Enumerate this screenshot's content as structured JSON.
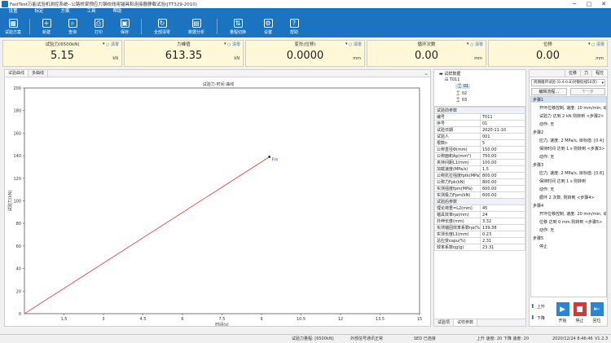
{
  "window": {
    "title": "FastTest万能试验机测控系统--公路桥梁预应力钢绞线用锚具和连接器静载试验(JTT329-2010)",
    "minimize": "─",
    "maximize": "□",
    "close": "✕"
  },
  "menu": [
    "设置",
    "标定",
    "方案",
    "工具",
    "帮助"
  ],
  "toolbar": [
    {
      "label": "试验方案",
      "icon": "grid-icon"
    },
    {
      "label": "新建",
      "icon": "plus-icon"
    },
    {
      "label": "查询",
      "icon": "search-icon"
    },
    {
      "label": "打印",
      "icon": "print-icon"
    },
    {
      "label": "保存",
      "icon": "save-icon"
    },
    {
      "label": "全部清零",
      "icon": "refresh-icon"
    },
    {
      "label": "数据分析",
      "icon": "chart-icon"
    },
    {
      "label": "量程切换",
      "icon": "range-icon"
    },
    {
      "label": "设置",
      "icon": "settings-icon"
    },
    {
      "label": "帮助",
      "icon": "help-icon"
    }
  ],
  "meters": [
    {
      "label": "试验力(6500kN)",
      "zero": "清零",
      "value": "5.15",
      "unit": "kN"
    },
    {
      "label": "力峰值",
      "zero": "清零",
      "value": "613.35",
      "unit": "kN"
    },
    {
      "label": "变形(位移)",
      "zero": "清零",
      "value": "0.0000",
      "unit": "mm"
    },
    {
      "label": "循环次数",
      "zero": "清零",
      "value": "0.00",
      "unit": "mm"
    },
    {
      "label": "位移",
      "zero": "清零",
      "value": "0.00",
      "unit": "mm"
    }
  ],
  "chart_tabs": [
    "试验曲线",
    "多曲线"
  ],
  "chart_data": {
    "type": "line",
    "title": "试验力-时间 曲线",
    "xlabel": "时间(s)",
    "ylabel": "试验力(kN)",
    "xlim": [
      0,
      15
    ],
    "ylim": [
      0,
      200
    ],
    "xticks": [
      "1.5",
      "3",
      "4.5",
      "6",
      "7.5",
      "9",
      "10.5",
      "12",
      "13.5",
      "15"
    ],
    "yticks": [
      "20",
      "40",
      "60",
      "80",
      "100",
      "120",
      "140",
      "160",
      "180",
      "200"
    ],
    "origin_label": "0",
    "series": [
      {
        "color": "#e03a3a",
        "x": [
          0,
          9.3
        ],
        "y": [
          0,
          139
        ]
      }
    ],
    "marker": {
      "x": 9.3,
      "y": 139,
      "label": "Fm"
    }
  },
  "tree": {
    "header": "试样数据",
    "root": "T011",
    "samples": [
      "01",
      "02",
      "03"
    ]
  },
  "params": [
    {
      "section": "试验前参数"
    },
    {
      "k": "编号",
      "v": "T011"
    },
    {
      "k": "序号",
      "v": "01"
    },
    {
      "k": "试验日期",
      "v": "2020-11-10"
    },
    {
      "k": "试验人",
      "v": "001"
    },
    {
      "k": "根数n",
      "v": "5"
    },
    {
      "k": "公称直径Φ(mm)",
      "v": "150.00"
    },
    {
      "k": "公称面积Ap(mm²)",
      "v": "750.00"
    },
    {
      "k": "夹持间距L1(mm)",
      "v": "100.00"
    },
    {
      "k": "加载速度(MPa/s)",
      "v": "1.5"
    },
    {
      "k": "公称抗拉强度fptk(MPa)",
      "v": "800.00"
    },
    {
      "k": "公称力Fpk(kN)",
      "v": "800.00"
    },
    {
      "k": "实测强度fpm(MPa)",
      "v": "600.00"
    },
    {
      "k": "实测极力Fpm(kN)",
      "v": "600.00"
    },
    {
      "section": "试验后参数"
    },
    {
      "k": "理论荷重=L2(mm)",
      "v": "45"
    },
    {
      "k": "锚具效率ηa(mm)",
      "v": "24"
    },
    {
      "k": "外伸长度(mm)",
      "v": "3.32"
    },
    {
      "k": "实测锚固效率系数ηa(%)",
      "v": "139.38"
    },
    {
      "k": "实测长度L1(mm)",
      "v": "0.23"
    },
    {
      "k": "总应变εapu(%)",
      "v": "2.31"
    },
    {
      "k": "效率系数ηg(g)",
      "v": "23.31"
    }
  ],
  "mid_tabs": [
    "试验项",
    "试样参数"
  ],
  "right_tabs": [
    "位移",
    "力",
    "程控"
  ],
  "program": {
    "select": "周期循环试验 (0.4-0.8)对钢绞线50次)",
    "edit_btn": "编辑流程...",
    "next_btn": "下一步",
    "steps": [
      {
        "title": "步骤1",
        "lines": [
          "开环位移控制, 速度: 10 mm/min, 动作:",
          "试验力 达到 2 kN 则转到 <步骤2>",
          "动作: 无"
        ]
      },
      {
        "title": "步骤2",
        "lines": [
          "应力, 速度: 2 MPa/s, 目标值: [0.4]",
          "保持时间 达到 1 s 则转到 <步骤3>",
          "动作: 无"
        ]
      },
      {
        "title": "步骤3",
        "lines": [
          "应力, 速度: 2 MPa/s, 目标值: [0.8]",
          "保持时间 达到 1 s 则转到",
          "动作: 无",
          "循环 2 次数, 则转到 <步骤4>"
        ]
      },
      {
        "title": "步骤4",
        "lines": [
          "开环位移控制, 速度: 20 mm/min, 动作",
          "位移 达到 0 mm 则转到 <步骤5>",
          "动作: 无"
        ]
      },
      {
        "title": "步骤5",
        "lines": [
          "停止"
        ]
      }
    ]
  },
  "controls": {
    "up": "上升",
    "down": "下降",
    "start": "开始",
    "stop": "停止",
    "return": "回位"
  },
  "status": {
    "range": "试验力量程: [6500kN]",
    "signal": "外部信号通讯正常",
    "sed": "SED 已连接",
    "limits": "上升 速度: 20  下降 速度: 20",
    "datetime": "2020/12/24 8:46:46",
    "version": "V1.2.3"
  }
}
